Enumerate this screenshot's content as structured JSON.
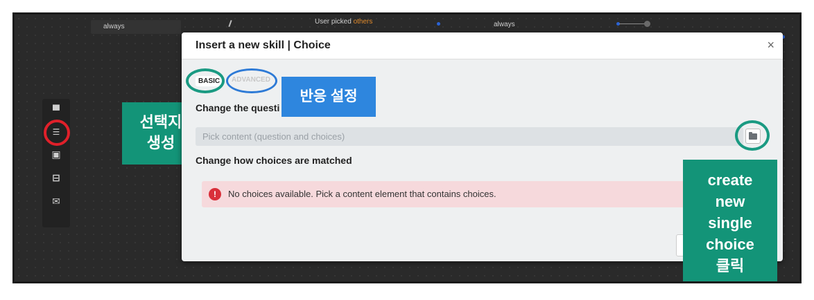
{
  "background_flow": {
    "label_always_1": "always",
    "label_user_picked": "User picked",
    "label_others": "others",
    "label_always_2": "always"
  },
  "toolbar": {
    "tools": [
      {
        "name": "message-icon",
        "glyph": "▀"
      },
      {
        "name": "choice-list-icon",
        "glyph": "☰"
      },
      {
        "name": "capture-icon",
        "glyph": "▣"
      },
      {
        "name": "split-icon",
        "glyph": "⊟"
      },
      {
        "name": "mail-icon",
        "glyph": "✉"
      }
    ]
  },
  "modal": {
    "title": "Insert a new skill | Choice",
    "close": "×",
    "tabs": {
      "basic": "BASIC",
      "advanced": "ADVANCED"
    },
    "section1_label": "Change the questi",
    "content_placeholder": "Pick content (question and choices)",
    "section2_label": "Change how choices are matched",
    "alert_icon": "!",
    "alert_text": "No choices available. Pick a content element that contains choices."
  },
  "annotations": {
    "reaction_settings": "반응 설정",
    "create_choices_line1": "선택지",
    "create_choices_line2": "생성",
    "create_single_choice": [
      "create",
      "new",
      "single",
      "choice",
      "클릭"
    ]
  },
  "colors": {
    "teal": "#139478",
    "blue": "#2e86de",
    "red": "#e0202a"
  }
}
